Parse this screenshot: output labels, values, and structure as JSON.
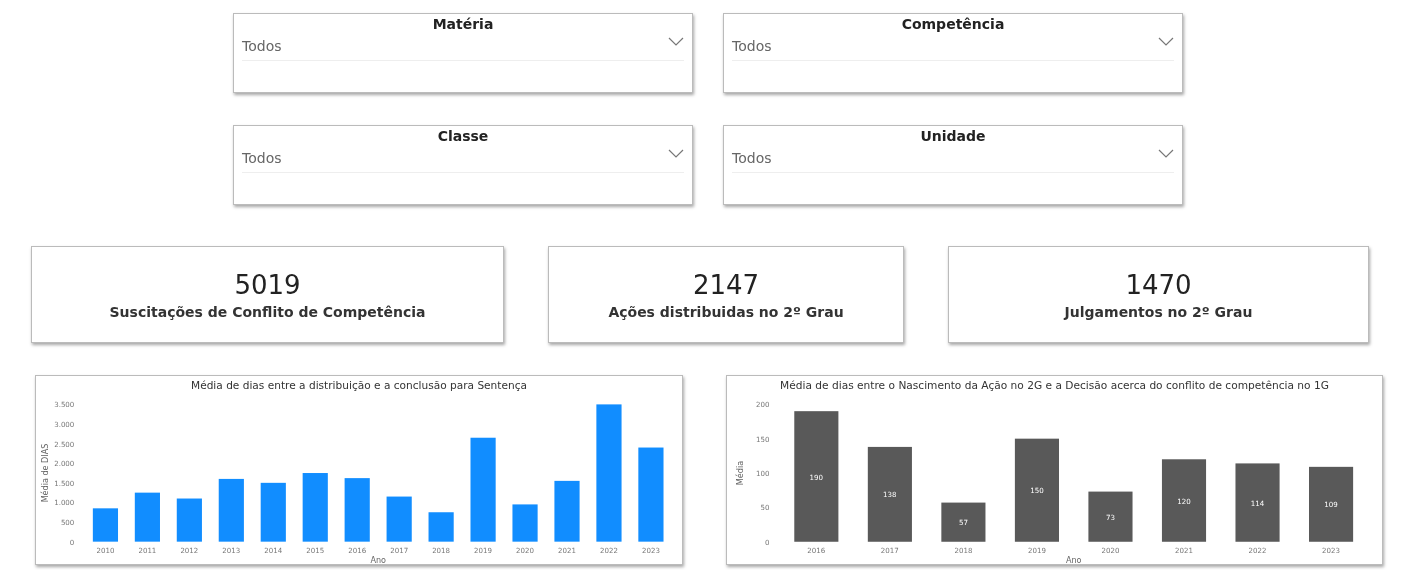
{
  "filters": [
    {
      "label": "Matéria",
      "value": "Todos"
    },
    {
      "label": "Competência",
      "value": "Todos"
    },
    {
      "label": "Classe",
      "value": "Todos"
    },
    {
      "label": "Unidade",
      "value": "Todos"
    }
  ],
  "kpis": [
    {
      "value": "5019",
      "label": "Suscitações de Conflito de Competência"
    },
    {
      "value": "2147",
      "label": "Ações distribuidas no 2º Grau"
    },
    {
      "value": "1470",
      "label": "Julgamentos no 2º Grau"
    }
  ],
  "charts": [
    {
      "chart_data": {
        "type": "bar",
        "title": "Média de dias entre a distribuição e a conclusão para Sentença",
        "xlabel": "Ano",
        "ylabel": "Média de DIAS",
        "categories": [
          "2010",
          "2011",
          "2012",
          "2013",
          "2014",
          "2015",
          "2016",
          "2017",
          "2018",
          "2019",
          "2020",
          "2021",
          "2022",
          "2023"
        ],
        "series": [
          {
            "color": "#118dff",
            "values": [
              850,
              1250,
              1100,
              1600,
              1500,
              1750,
              1620,
              1150,
              750,
              2650,
              950,
              1550,
              3500,
              2400
            ]
          }
        ],
        "ylim": [
          0,
          3500
        ],
        "yticks": [
          {
            "value": 0,
            "label": "0"
          },
          {
            "value": 500,
            "label": "500"
          },
          {
            "value": 1000,
            "label": "1.000"
          },
          {
            "value": 1500,
            "label": "1.500"
          },
          {
            "value": 2000,
            "label": "2.000"
          },
          {
            "value": 2500,
            "label": "2.500"
          },
          {
            "value": 3000,
            "label": "3.000"
          },
          {
            "value": 3500,
            "label": "3.500"
          }
        ]
      }
    },
    {
      "chart_data": {
        "type": "bar",
        "title": "Média de dias entre o Nascimento da Ação no 2G e a Decisão acerca do conflito de competência no 1G",
        "xlabel": "Ano",
        "ylabel": "Média",
        "categories": [
          "2016",
          "2017",
          "2018",
          "2019",
          "2020",
          "2021",
          "2022",
          "2023"
        ],
        "series": [
          {
            "color": "#595959",
            "values": [
              190,
              138,
              57,
              150,
              73,
              120,
              114,
              109
            ]
          }
        ],
        "ylim": [
          0,
          200
        ],
        "yticks": [
          0,
          50,
          100,
          150,
          200
        ],
        "data_labels": true
      }
    }
  ]
}
